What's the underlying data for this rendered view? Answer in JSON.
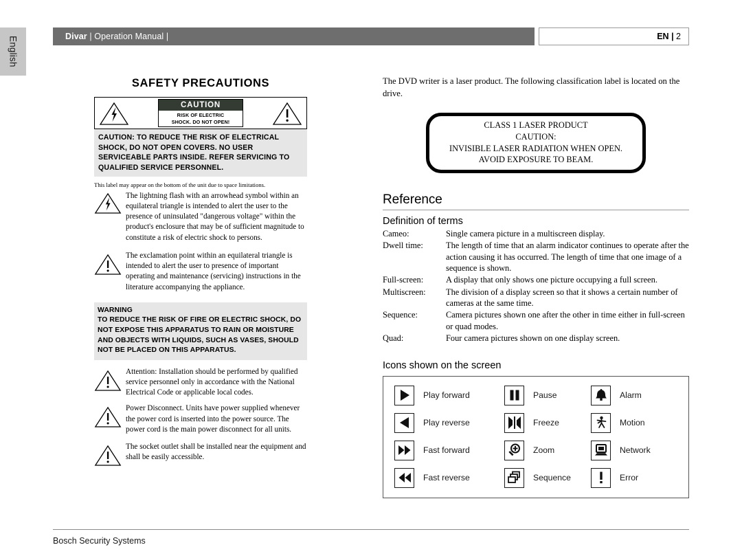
{
  "sidebar": {
    "language_tab": "English"
  },
  "header": {
    "product": "Divar",
    "doc_title": "Operation Manual",
    "separator": "|",
    "language_code": "EN",
    "page_number": "2",
    "bar_color": "#6e6e6e"
  },
  "safety": {
    "title": "SAFETY PRECAUTIONS",
    "caution_badge_title": "CAUTION",
    "caution_badge_line1": "RISK OF ELECTRIC",
    "caution_badge_line2": "SHOCK. DO NOT OPEN!",
    "caution_body": "CAUTION: TO REDUCE THE RISK OF ELECTRICAL SHOCK, DO NOT OPEN COVERS. NO USER SERVICEABLE PARTS INSIDE. REFER SERVICING TO QUALIFIED SERVICE PERSONNEL.",
    "label_note": "This label may appear on the bottom of the unit due to space limitations.",
    "lightning_text": "The lightning flash with an arrowhead symbol within an equilateral triangle is intended to alert the user to the presence of uninsulated \"dangerous voltage\" within the product's enclosure that may be of sufficient magnitude to constitute a risk of electric shock to persons.",
    "exclamation_text": "The exclamation point within an equilateral triangle is intended to alert the user to presence of important operating and maintenance (servicing) instructions in the literature accompanying the appliance.",
    "warning_heading": "WARNING",
    "warning_text": "TO REDUCE THE RISK OF FIRE OR ELECTRIC SHOCK, DO NOT EXPOSE THIS APPARATUS TO RAIN OR MOISTURE AND OBJECTS WITH LIQUIDS, SUCH AS VASES, SHOULD NOT BE PLACED ON THIS APPARATUS.",
    "attention_text": "Attention:  Installation should be performed by qualified service personnel only in accordance with the National Electrical Code or applicable local codes.",
    "power_disconnect_text": "Power Disconnect. Units have power supplied whenever the power cord is inserted into the power source. The power cord is the main power disconnect for all units.",
    "socket_outlet_text": "The socket outlet shall be installed near the equipment and shall be easily accessible."
  },
  "laser": {
    "intro": "The DVD writer is a laser product. The following classification label is located on the drive.",
    "line1": "CLASS 1 LASER PRODUCT",
    "line2": "CAUTION:",
    "line3": "INVISIBLE LASER RADIATION WHEN OPEN.",
    "line4": "AVOID EXPOSURE TO BEAM."
  },
  "reference": {
    "section_title": "Reference",
    "definitions_title": "Definition of terms",
    "terms": [
      {
        "term": "Cameo:",
        "definition": "Single camera picture in a multiscreen display."
      },
      {
        "term": "Dwell time:",
        "definition": "The length of time that an alarm indicator continues to operate after the action causing it has occurred. The length of time that one image of a sequence is shown."
      },
      {
        "term": "Full-screen:",
        "definition": "A display that only shows one picture occupying a full screen."
      },
      {
        "term": "Multiscreen:",
        "definition": "The division of a display screen so that it shows a certain number of cameras at the same time."
      },
      {
        "term": "Sequence:",
        "definition": "Camera pictures shown one after the other in time either in full-screen or quad modes."
      },
      {
        "term": "Quad:",
        "definition": "Four camera pictures shown on one display screen."
      }
    ],
    "icons_title": "Icons shown on the screen",
    "icons": [
      {
        "name": "play-forward-icon",
        "label": "Play forward"
      },
      {
        "name": "pause-icon",
        "label": "Pause"
      },
      {
        "name": "alarm-bell-icon",
        "label": "Alarm"
      },
      {
        "name": "play-reverse-icon",
        "label": "Play reverse"
      },
      {
        "name": "freeze-icon",
        "label": "Freeze"
      },
      {
        "name": "motion-icon",
        "label": "Motion"
      },
      {
        "name": "fast-forward-icon",
        "label": "Fast forward"
      },
      {
        "name": "zoom-icon",
        "label": "Zoom"
      },
      {
        "name": "network-icon",
        "label": "Network"
      },
      {
        "name": "fast-reverse-icon",
        "label": "Fast reverse"
      },
      {
        "name": "sequence-icon",
        "label": "Sequence"
      },
      {
        "name": "error-icon",
        "label": "Error"
      }
    ]
  },
  "footer": {
    "company": "Bosch Security Systems"
  }
}
